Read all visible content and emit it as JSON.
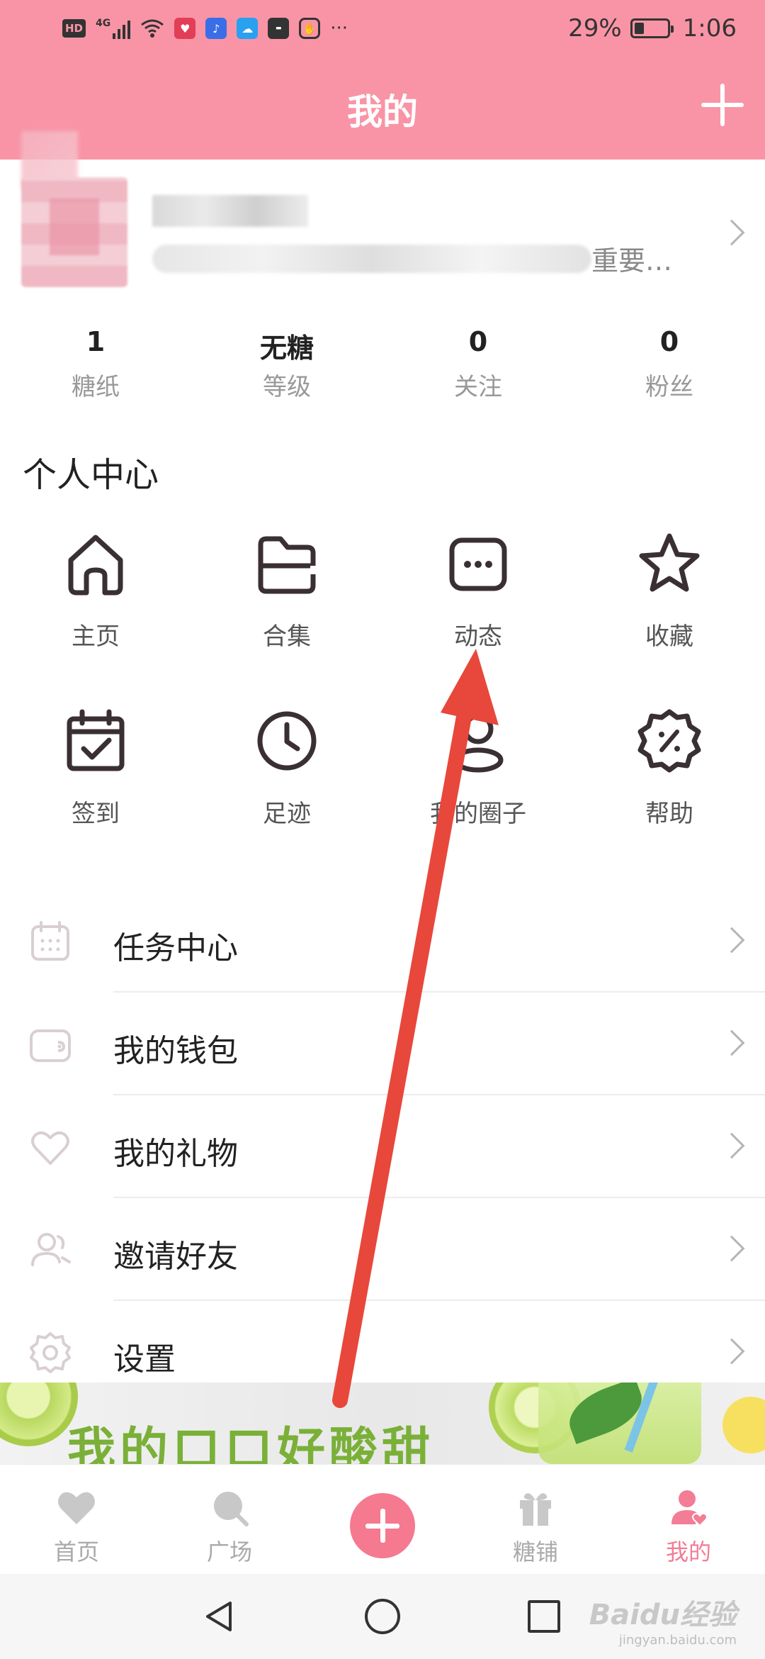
{
  "status_bar": {
    "hd_label": "HD",
    "signal_label": "4G",
    "more_label": "···",
    "battery_text": "29%",
    "battery_level": 0.29,
    "time": "1:06"
  },
  "header": {
    "title": "我的"
  },
  "profile": {
    "sign_text": "重要…"
  },
  "stats": [
    {
      "value": "1",
      "label": "糖纸"
    },
    {
      "value": "无糖",
      "label": "等级"
    },
    {
      "value": "0",
      "label": "关注"
    },
    {
      "value": "0",
      "label": "粉丝"
    }
  ],
  "personal_center": {
    "title": "个人中心",
    "items": [
      {
        "label": "主页",
        "icon": "home-icon"
      },
      {
        "label": "合集",
        "icon": "folder-icon"
      },
      {
        "label": "动态",
        "icon": "message-dots-icon"
      },
      {
        "label": "收藏",
        "icon": "star-icon"
      },
      {
        "label": "签到",
        "icon": "calendar-check-icon"
      },
      {
        "label": "足迹",
        "icon": "clock-icon"
      },
      {
        "label": "我的圈子",
        "icon": "circle-user-icon"
      },
      {
        "label": "帮助",
        "icon": "help-badge-icon"
      }
    ]
  },
  "menu_list": [
    {
      "label": "任务中心",
      "icon": "calendar-icon"
    },
    {
      "label": "我的钱包",
      "icon": "wallet-icon"
    },
    {
      "label": "我的礼物",
      "icon": "heart-icon"
    },
    {
      "label": "邀请好友",
      "icon": "invite-friends-icon"
    },
    {
      "label": "设置",
      "icon": "gear-icon"
    }
  ],
  "banner": {
    "text": "我的口口好酸甜"
  },
  "tab_bar": {
    "tabs": [
      {
        "label": "首页",
        "icon": "heart-icon"
      },
      {
        "label": "广场",
        "icon": "search-bubble-icon"
      },
      {
        "label": "",
        "icon": "plus-icon"
      },
      {
        "label": "糖铺",
        "icon": "gift-icon"
      },
      {
        "label": "我的",
        "icon": "user-heart-icon"
      }
    ],
    "active": "我的"
  },
  "watermark": {
    "text": "Baidu经验",
    "sub": "jingyan.baidu.com"
  },
  "colors": {
    "header_pink": "#f994a6",
    "accent_pink": "#f27d95",
    "annotation_arrow": "#e8473b"
  }
}
